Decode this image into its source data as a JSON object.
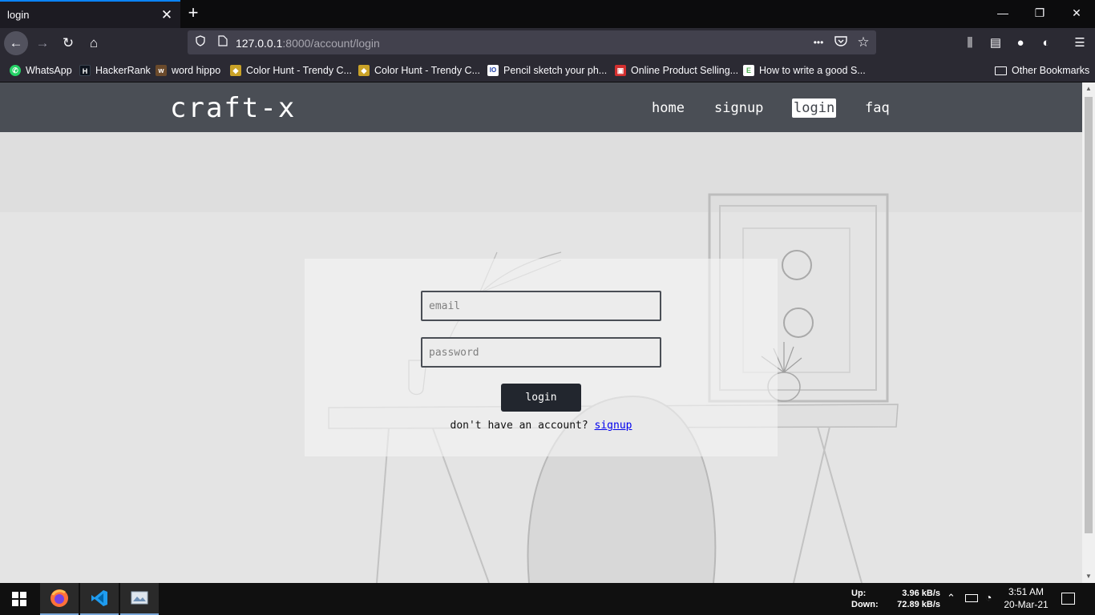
{
  "browser": {
    "tab_title": "login",
    "tab_close": "✕",
    "new_tab": "+",
    "window_controls": {
      "minimize": "—",
      "restore": "❐",
      "close": "✕"
    },
    "nav": {
      "back": "←",
      "forward": "→",
      "reload": "↻",
      "home": "⌂"
    },
    "url_host": "127.0.0.1",
    "url_rest": ":8000/account/login",
    "url_actions": {
      "more": "•••",
      "pocket": "✓",
      "bookmark": "☆"
    },
    "right_icons": {
      "library": "⫼",
      "sidebar": "▤",
      "account": "●",
      "extension": "◐",
      "menu": "☰"
    }
  },
  "bookmarks": [
    {
      "label": "WhatsApp",
      "icon": "whatsapp-icon",
      "color": "#25d366",
      "glyph": "✆"
    },
    {
      "label": "HackerRank",
      "icon": "hackerrank-icon",
      "color": "#0e141e",
      "glyph": "H"
    },
    {
      "label": "word hippo",
      "icon": "wordhippo-icon",
      "color": "#6b4a2b",
      "glyph": "w"
    },
    {
      "label": "Color Hunt - Trendy C...",
      "icon": "colorhunt-icon",
      "color": "#c9a227",
      "glyph": "◆"
    },
    {
      "label": "Color Hunt - Trendy C...",
      "icon": "colorhunt-icon",
      "color": "#c9a227",
      "glyph": "◆"
    },
    {
      "label": "Pencil sketch your ph...",
      "icon": "io-icon",
      "color": "#1f3fa8",
      "glyph": "IO"
    },
    {
      "label": "Online Product Selling...",
      "icon": "product-icon",
      "color": "#d32f2f",
      "glyph": "▣"
    },
    {
      "label": "How to write a good S...",
      "icon": "exe-icon",
      "color": "#4caf50",
      "glyph": "E"
    }
  ],
  "other_bookmarks": "Other Bookmarks",
  "site": {
    "brand": "craft-x",
    "nav": [
      {
        "label": "home",
        "active": false
      },
      {
        "label": "signup",
        "active": false
      },
      {
        "label": "login",
        "active": true
      },
      {
        "label": "faq",
        "active": false
      }
    ]
  },
  "form": {
    "email_placeholder": "email",
    "password_placeholder": "password",
    "submit_label": "login",
    "signup_prompt": "don't have an account?",
    "signup_link": "signup"
  },
  "taskbar": {
    "up_label": "Up:",
    "down_label": "Down:",
    "up_speed": "3.96 kB/s",
    "down_speed": "72.89 kB/s",
    "time": "3:51 AM",
    "date": "20-Mar-21"
  }
}
